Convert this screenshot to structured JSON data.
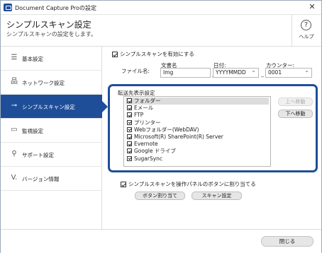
{
  "window": {
    "title": "Document Capture Proの設定",
    "close_glyph": "✕"
  },
  "header": {
    "title": "シンプルスキャン設定",
    "subtitle": "シンプルスキャンの設定をします。",
    "help_glyph": "?",
    "help_label": "ヘルプ"
  },
  "sidebar": {
    "items": [
      {
        "label": "基本設定",
        "icon": "list-icon",
        "glyph": "☰",
        "active": false
      },
      {
        "label": "ネットワーク設定",
        "icon": "network-icon",
        "glyph": "品",
        "active": false
      },
      {
        "label": "シンプルスキャン設定",
        "icon": "scan-icon",
        "glyph": "⊸",
        "active": true
      },
      {
        "label": "監視設定",
        "icon": "folder-icon",
        "glyph": "▭",
        "active": false
      },
      {
        "label": "サポート設定",
        "icon": "key-icon",
        "glyph": "⚲",
        "active": false
      },
      {
        "label": "バージョン情報",
        "icon": "version-icon",
        "glyph": "V.",
        "active": false
      }
    ]
  },
  "main": {
    "enable_label": "シンプルスキャンを有効にする",
    "enable_checked": true,
    "filename": {
      "label": "ファイル名:",
      "doc_label": "文書名",
      "doc_value": "Img",
      "date_label": "日付:",
      "date_value": "YYYYMMDD",
      "counter_label": "カウンター:",
      "counter_value": "0001",
      "separator": "_"
    },
    "destinations": {
      "label": "転送先表示設定",
      "items": [
        {
          "label": "フォルダー",
          "checked": true,
          "selected": true
        },
        {
          "label": "Eメール",
          "checked": true,
          "selected": false
        },
        {
          "label": "FTP",
          "checked": true,
          "selected": false
        },
        {
          "label": "プリンター",
          "checked": true,
          "selected": false
        },
        {
          "label": "Webフォルダー(WebDAV)",
          "checked": true,
          "selected": false
        },
        {
          "label": "Microsoft(R) SharePoint(R) Server",
          "checked": true,
          "selected": false
        },
        {
          "label": "Evernote",
          "checked": true,
          "selected": false
        },
        {
          "label": "Google ドライブ",
          "checked": true,
          "selected": false
        },
        {
          "label": "SugarSync",
          "checked": true,
          "selected": false
        }
      ],
      "move_up_label": "上へ移動",
      "move_down_label": "下へ移動"
    },
    "assign_label": "シンプルスキャンを操作パネルのボタンに割り当てる",
    "assign_checked": true,
    "assign_button_label": "ボタン割り当て",
    "scan_settings_button_label": "スキャン設定"
  },
  "footer": {
    "close_label": "閉じる"
  },
  "colors": {
    "accent": "#1f4e98"
  }
}
